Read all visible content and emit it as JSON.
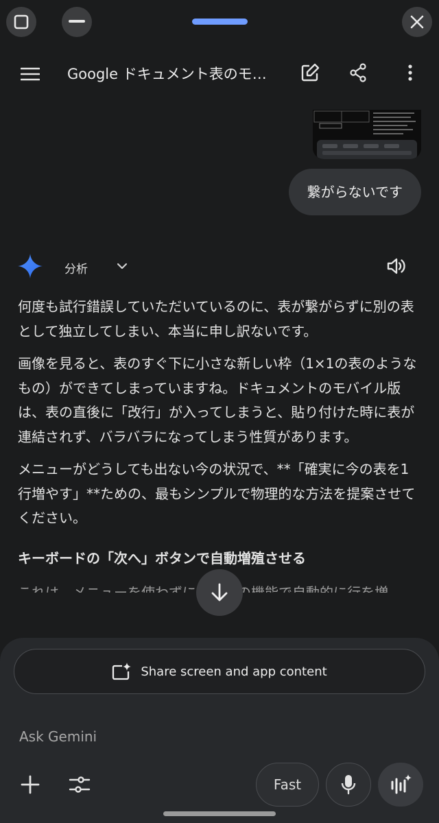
{
  "header": {
    "title": "Google ドキュメント表のモ…"
  },
  "conversation": {
    "user_message": "繋がらないです",
    "model_label": "分析",
    "paragraphs": [
      "何度も試行錯誤していただいているのに、表が繋がらずに別の表として独立してしまい、本当に申し訳ないです。",
      "画像を見ると、表のすぐ下に小さな新しい枠（1×1の表のようなもの）ができてしまっていますね。ドキュメントのモバイル版は、表の直後に「改行」が入ってしまうと、貼り付けた時に表が連結されず、バラバラになってしまう性質があります。",
      "メニューがどうしても出ない今の状況で、**「確実に今の表を1行増やす」**ための、最もシンプルで物理的な方法を提案させてください。"
    ],
    "heading": "キーボードの「次へ」ボタンで自動増殖させる",
    "cut_line": "これは、メニューを使わずにアプリの機能で自動的に行を増"
  },
  "composer": {
    "share_label": "Share screen and app content",
    "placeholder": "Ask Gemini",
    "mode_label": "Fast"
  },
  "colors": {
    "background": "#1b1c1d",
    "accent_pill": "#6f9cff",
    "composer": "#27292c"
  }
}
